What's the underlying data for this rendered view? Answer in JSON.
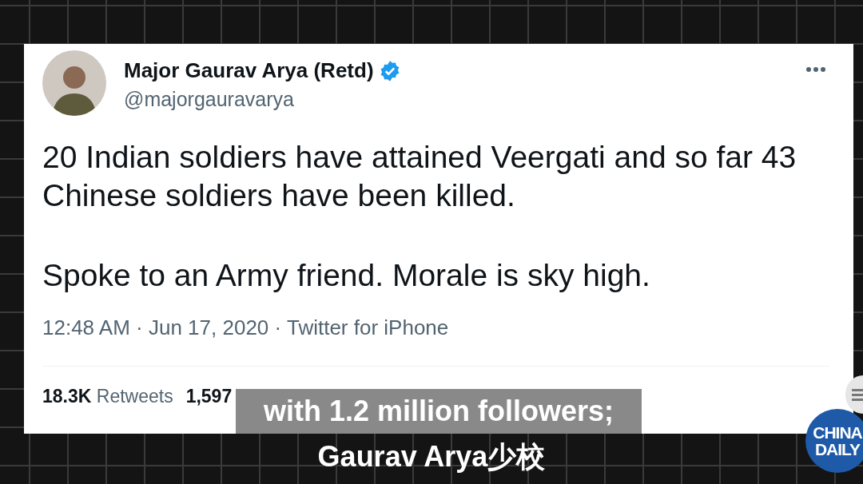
{
  "tweet": {
    "author_name": "Major Gaurav Arya (Retd)",
    "verified": true,
    "handle": "@majorgauravarya",
    "paragraphs": [
      "20 Indian soldiers have attained Veergati and so far 43 Chinese soldiers have been killed.",
      "Spoke to an Army friend. Morale is sky high."
    ],
    "meta": "12:48 AM · Jun 17, 2020 · Twitter for iPhone",
    "stats": [
      {
        "count": "18.3K",
        "label": "Retweets"
      },
      {
        "count": "1,597"
      }
    ]
  },
  "subtitles": [
    "with 1.2 million followers;",
    "Gaurav Arya少校"
  ],
  "channel_logo": [
    "CHINA",
    "DAILY"
  ]
}
